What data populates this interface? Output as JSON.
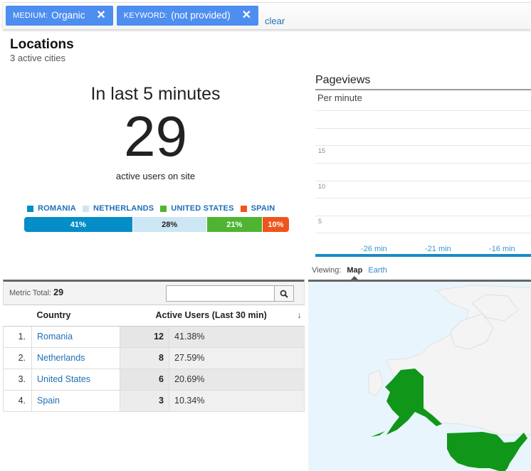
{
  "filters": [
    {
      "key": "MEDIUM:",
      "value": "Organic"
    },
    {
      "key": "KEYWORD:",
      "value": "(not provided)"
    }
  ],
  "filter_clear_label": "clear",
  "locations": {
    "title": "Locations",
    "subtitle": "3 active cities"
  },
  "summary": {
    "heading": "In last 5 minutes",
    "active_users": "29",
    "caption": "active users on site"
  },
  "legend": [
    {
      "label": "ROMANIA",
      "color": "#058dc7",
      "pct": "41%",
      "share": 41,
      "text_color": "#ffffff"
    },
    {
      "label": "NETHERLANDS",
      "color": "#cde6f3",
      "pct": "28%",
      "share": 28,
      "text_color": "#222222"
    },
    {
      "label": "UNITED STATES",
      "color": "#50b432",
      "pct": "21%",
      "share": 21,
      "text_color": "#ffffff"
    },
    {
      "label": "SPAIN",
      "color": "#ed561b",
      "pct": "10%",
      "share": 10,
      "text_color": "#ffffff"
    }
  ],
  "pageviews": {
    "title": "Pageviews",
    "subtitle": "Per minute"
  },
  "chart_data": {
    "type": "bar",
    "title": "Pageviews",
    "subtitle": "Per minute",
    "xlabel": "",
    "ylabel": "",
    "y_ticks": [
      "15",
      "10",
      "5"
    ],
    "x_ticks": [
      "-26 min",
      "-21 min",
      "-16 min"
    ],
    "ylim": [
      0,
      20
    ],
    "grid": true,
    "series": []
  },
  "viewing": {
    "label": "Viewing:",
    "options": [
      "Map",
      "Earth"
    ],
    "selected": "Map"
  },
  "map": {
    "highlight_color": "#109618",
    "land_color": "#f5f5f5",
    "water_color": "#e9f5fd",
    "highlighted": [
      "United States"
    ]
  },
  "table": {
    "metric_total_label": "Metric Total:",
    "metric_total_value": "29",
    "search_placeholder": "",
    "columns": [
      "Country",
      "Active Users (Last 30 min)"
    ],
    "sort_icon": "arrow-down-icon",
    "rows": [
      {
        "index": "1.",
        "country": "Romania",
        "value": "12",
        "percent": "41.38%"
      },
      {
        "index": "2.",
        "country": "Netherlands",
        "value": "8",
        "percent": "27.59%"
      },
      {
        "index": "3.",
        "country": "United States",
        "value": "6",
        "percent": "20.69%"
      },
      {
        "index": "4.",
        "country": "Spain",
        "value": "3",
        "percent": "10.34%"
      }
    ]
  }
}
